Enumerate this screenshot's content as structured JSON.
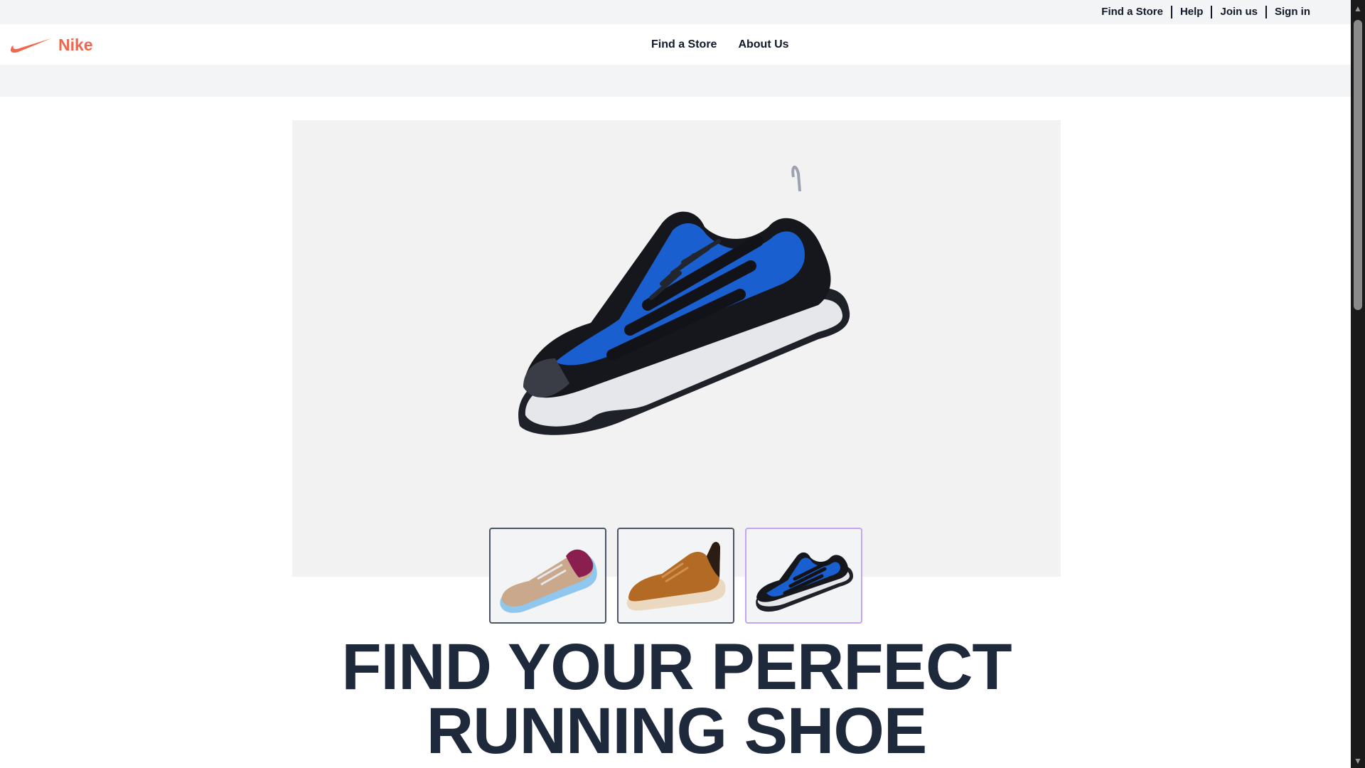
{
  "utility_bar": {
    "links": [
      "Find a Store",
      "Help",
      "Join us",
      "Sign in"
    ]
  },
  "nav": {
    "brand_name": "Nike",
    "brand_icon": "swoosh-icon",
    "links": [
      "Find a Store",
      "About Us"
    ]
  },
  "hero": {
    "main_image": "blue-black-trail-running-shoe",
    "thumbnails": [
      {
        "image": "tan-purple-running-shoe",
        "selected": false
      },
      {
        "image": "brown-leather-sneaker",
        "selected": false
      },
      {
        "image": "blue-black-trail-running-shoe",
        "selected": true
      }
    ]
  },
  "headline": {
    "line1": "FIND YOUR PERFECT",
    "line2": "RUNNING SHOE"
  },
  "colors": {
    "brand_accent": "#f0664d",
    "headline": "#1e293b",
    "panel_bg": "#f2f2f3",
    "selected_thumb_border": "#c4a5f5"
  }
}
